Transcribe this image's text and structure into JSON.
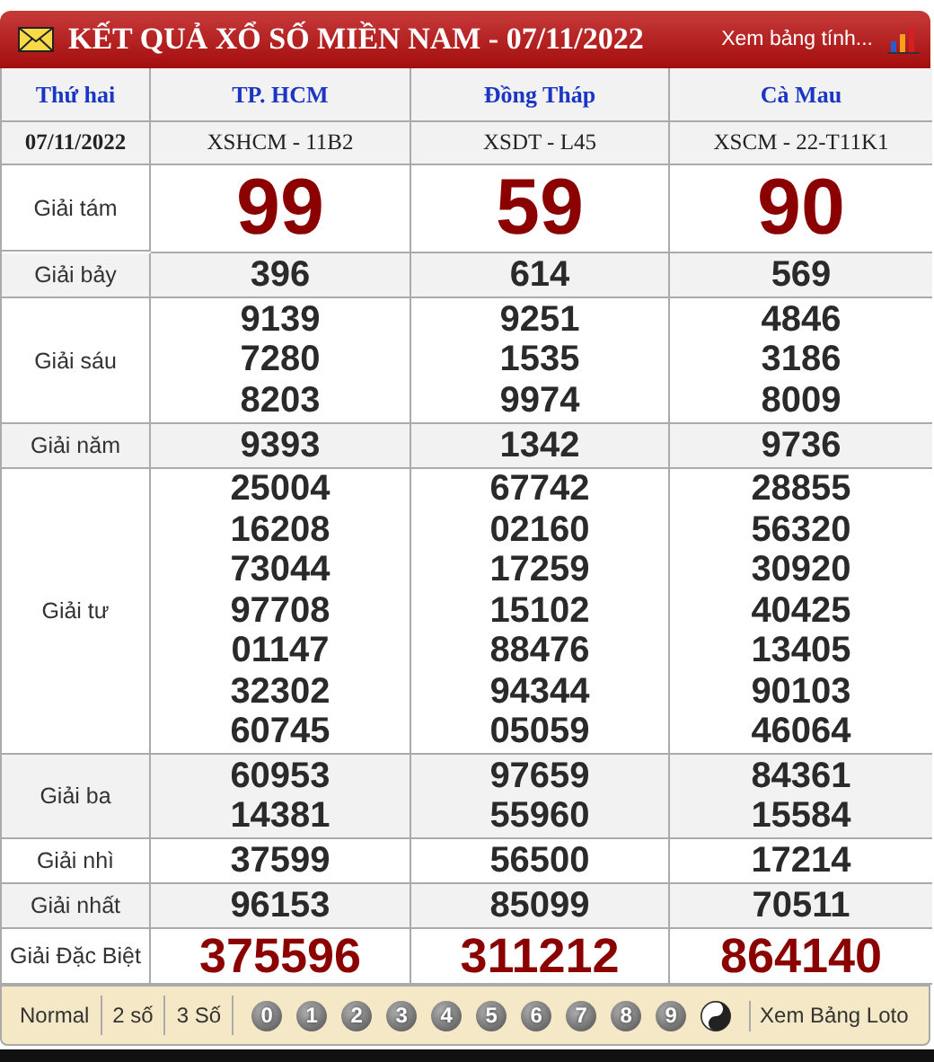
{
  "header": {
    "title": "KẾT QUẢ XỔ SỐ MIỀN NAM - 07/11/2022",
    "link": "Xem bảng tính..."
  },
  "columns": [
    {
      "label": "Thứ hai",
      "code": "07/11/2022"
    },
    {
      "label": "TP. HCM",
      "code": "XSHCM - 11B2"
    },
    {
      "label": "Đồng Tháp",
      "code": "XSDT - L45"
    },
    {
      "label": "Cà Mau",
      "code": "XSCM - 22-T11K1"
    }
  ],
  "prizes": [
    {
      "name": "Giải tám",
      "kind": "big",
      "values": [
        [
          "99"
        ],
        [
          "59"
        ],
        [
          "90"
        ]
      ]
    },
    {
      "name": "Giải bảy",
      "kind": "normal",
      "values": [
        [
          "396"
        ],
        [
          "614"
        ],
        [
          "569"
        ]
      ]
    },
    {
      "name": "Giải sáu",
      "kind": "normal",
      "values": [
        [
          "9139",
          "7280",
          "8203"
        ],
        [
          "9251",
          "1535",
          "9974"
        ],
        [
          "4846",
          "3186",
          "8009"
        ]
      ]
    },
    {
      "name": "Giải năm",
      "kind": "normal",
      "values": [
        [
          "9393"
        ],
        [
          "1342"
        ],
        [
          "9736"
        ]
      ]
    },
    {
      "name": "Giải tư",
      "kind": "normal",
      "values": [
        [
          "25004",
          "16208",
          "73044",
          "97708",
          "01147",
          "32302",
          "60745"
        ],
        [
          "67742",
          "02160",
          "17259",
          "15102",
          "88476",
          "94344",
          "05059"
        ],
        [
          "28855",
          "56320",
          "30920",
          "40425",
          "13405",
          "90103",
          "46064"
        ]
      ]
    },
    {
      "name": "Giải ba",
      "kind": "normal",
      "values": [
        [
          "60953",
          "14381"
        ],
        [
          "97659",
          "55960"
        ],
        [
          "84361",
          "15584"
        ]
      ]
    },
    {
      "name": "Giải nhì",
      "kind": "normal",
      "values": [
        [
          "37599"
        ],
        [
          "56500"
        ],
        [
          "17214"
        ]
      ]
    },
    {
      "name": "Giải nhất",
      "kind": "normal",
      "values": [
        [
          "96153"
        ],
        [
          "85099"
        ],
        [
          "70511"
        ]
      ]
    },
    {
      "name": "Giải Đặc Biệt",
      "kind": "special",
      "values": [
        [
          "375596"
        ],
        [
          "311212"
        ],
        [
          "864140"
        ]
      ]
    }
  ],
  "footer": {
    "modes": [
      "Normal",
      "2 số",
      "3 Số"
    ],
    "digits": [
      "0",
      "1",
      "2",
      "3",
      "4",
      "5",
      "6",
      "7",
      "8",
      "9"
    ],
    "link": "Xem Bảng Loto"
  }
}
